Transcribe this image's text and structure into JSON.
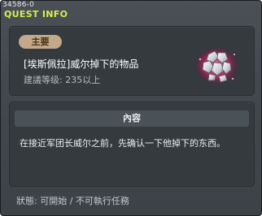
{
  "window": {
    "id_tag": "34586-0",
    "title": "QUEST INFO"
  },
  "quest": {
    "badge": "主要",
    "name": "[埃斯佩拉]威尔掉下的物品",
    "level": "建議等级: 235以上",
    "item_icon": "silver-crystal-cluster-icon"
  },
  "content": {
    "header": "內容",
    "text": "在接近军团长威尔之前，先确认一下他掉下的东西。"
  },
  "status": "狀態: 可開始 / 不可執行任務",
  "colors": {
    "title": "#d9ee4b",
    "badge": "#c3a88a",
    "glow": "#e0307a"
  }
}
